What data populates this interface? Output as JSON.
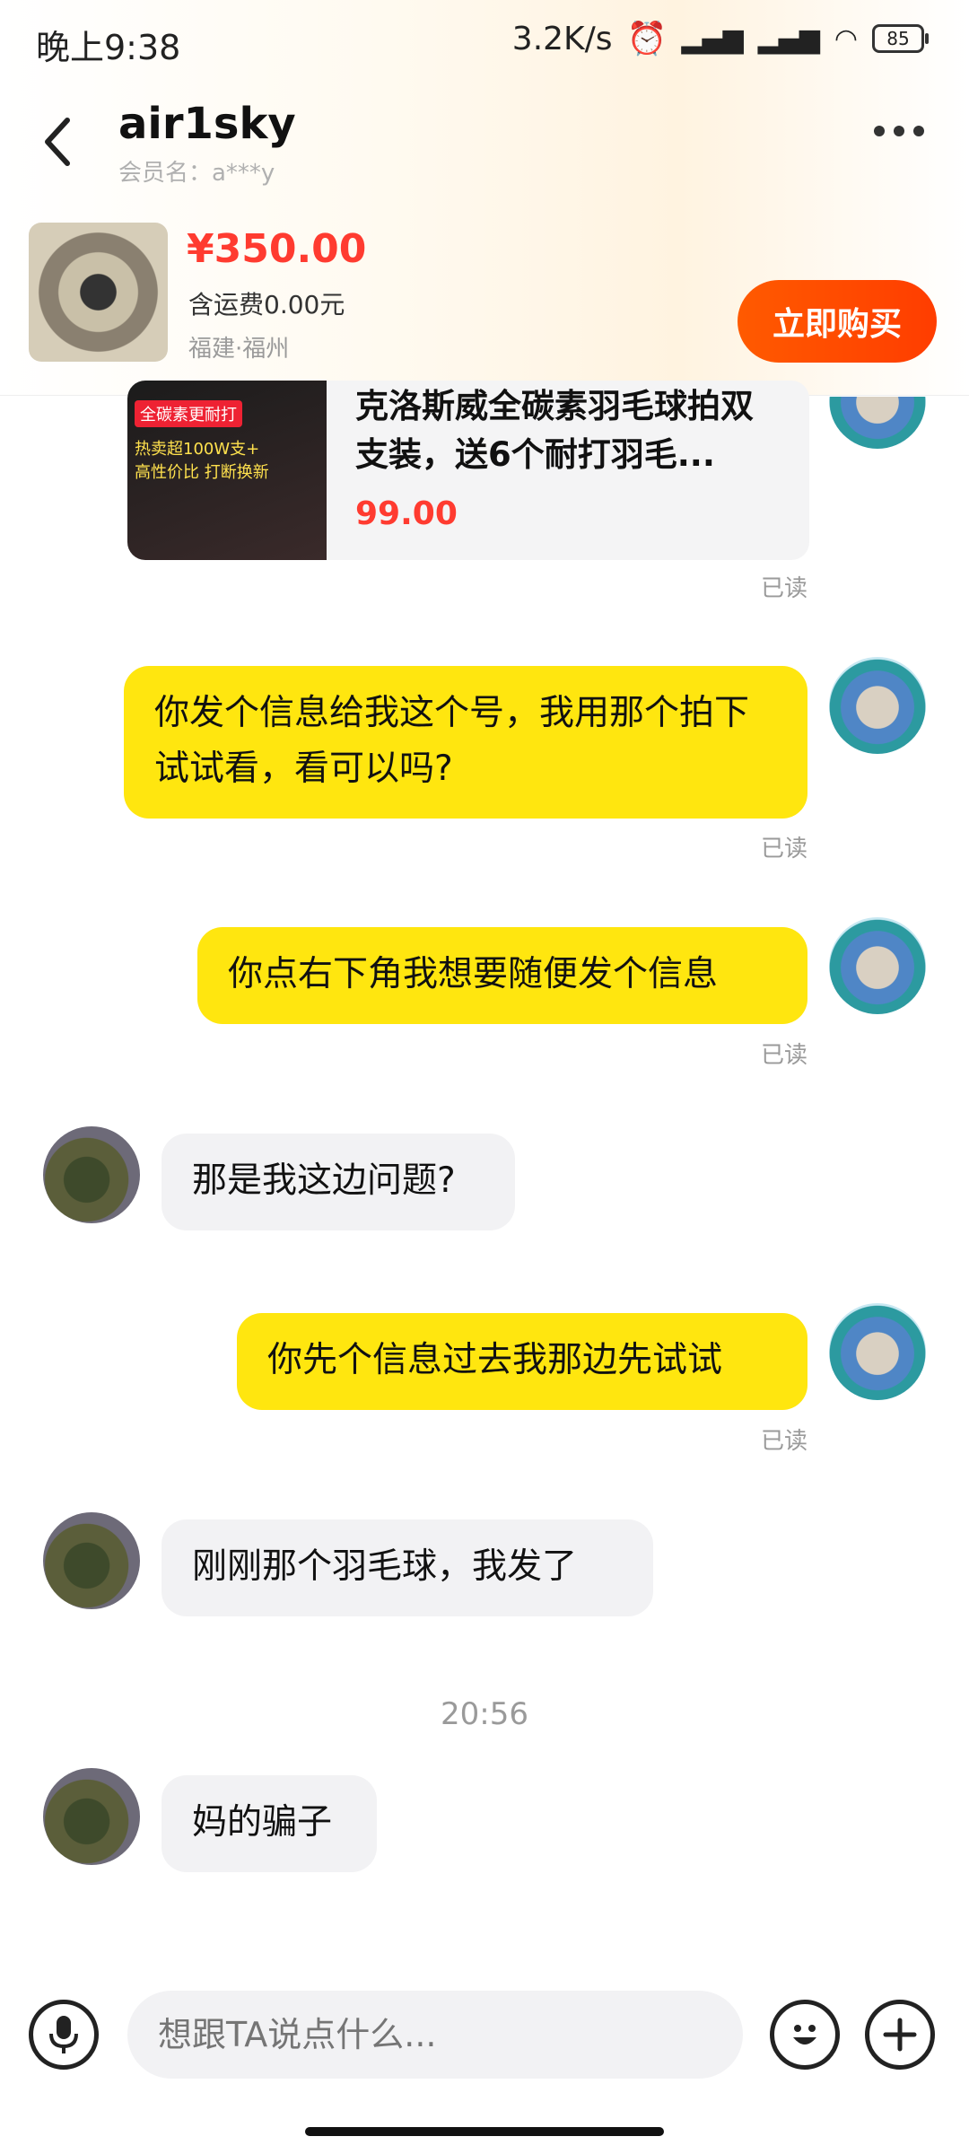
{
  "status_bar": {
    "time": "晚上9:38",
    "speed": "3.2K/s",
    "battery": "85"
  },
  "header": {
    "title": "air1sky",
    "member_label": "会员名：a***y"
  },
  "product": {
    "price": "¥350.00",
    "shipping": "含运费0.00元",
    "location": "福建·福州",
    "buy_label": "立即购买"
  },
  "shared_card": {
    "img_tag1": "全碳素更耐打",
    "img_tag2": "热卖超100W支+",
    "img_tag3": "高性价比 打断换新",
    "title": "克洛斯威全碳素羽毛球拍双支装，送6个耐打羽毛...",
    "price": "99.00"
  },
  "messages": [
    {
      "from": "me",
      "text": "你发个信息给我这个号，我用那个拍下试试看，看可以吗?",
      "status": "已读"
    },
    {
      "from": "me",
      "text": "你点右下角我想要随便发个信息",
      "status": "已读"
    },
    {
      "from": "them",
      "text": "那是我这边问题?"
    },
    {
      "from": "me",
      "text": "你先个信息过去我那边先试试",
      "status": "已读"
    },
    {
      "from": "them",
      "text": "刚刚那个羽毛球，我发了"
    },
    {
      "from": "them",
      "text": "妈的骗子"
    }
  ],
  "card_status": "已读",
  "timestamp": "20:56",
  "input": {
    "placeholder": "想跟TA说点什么..."
  },
  "icons": {
    "back": "chevron-left-icon",
    "more": "more-dots-icon",
    "voice": "microphone-icon",
    "emoji": "emoji-icon",
    "add": "plus-icon"
  },
  "colors": {
    "accent": "#ff4a00",
    "price": "#ff3b30",
    "my_bubble": "#ffe60f",
    "their_bubble": "#f2f2f4"
  }
}
